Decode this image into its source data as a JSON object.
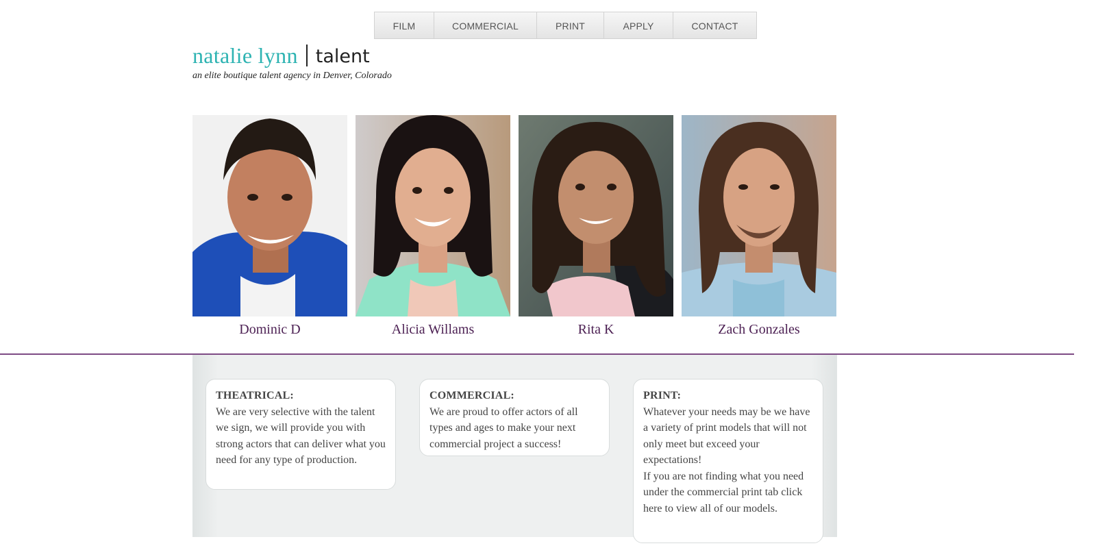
{
  "nav": {
    "items": [
      {
        "label": "FILM"
      },
      {
        "label": "COMMERCIAL"
      },
      {
        "label": "PRINT"
      },
      {
        "label": "APPLY"
      },
      {
        "label": "CONTACT"
      }
    ]
  },
  "logo": {
    "name": "natalie lynn",
    "suffix": "talent",
    "tagline": "an elite boutique talent agency in Denver, Colorado"
  },
  "talent": [
    {
      "name": "Dominic D"
    },
    {
      "name": "Alicia Willams"
    },
    {
      "name": "Rita K"
    },
    {
      "name": "Zach Gonzales"
    }
  ],
  "services": {
    "theatrical": {
      "title": "THEATRICAL:",
      "body": "We are very selective with the talent we sign, we will provide you with strong actors that can deliver what you need for any type of production."
    },
    "commercial": {
      "title": "COMMERCIAL:",
      "body": "We are proud to offer actors of all types and ages to make your next commercial project a success!"
    },
    "print": {
      "title": "PRINT:",
      "body": "Whatever your needs may be we have a variety of print models that will not only meet but exceed your expectations!",
      "body2": "If you are not finding what you need under the commercial print tab click here to view all of our models."
    }
  },
  "colors": {
    "brand_teal": "#2db3b2",
    "name_purple": "#4b1f52",
    "divider": "#7d4a84"
  }
}
